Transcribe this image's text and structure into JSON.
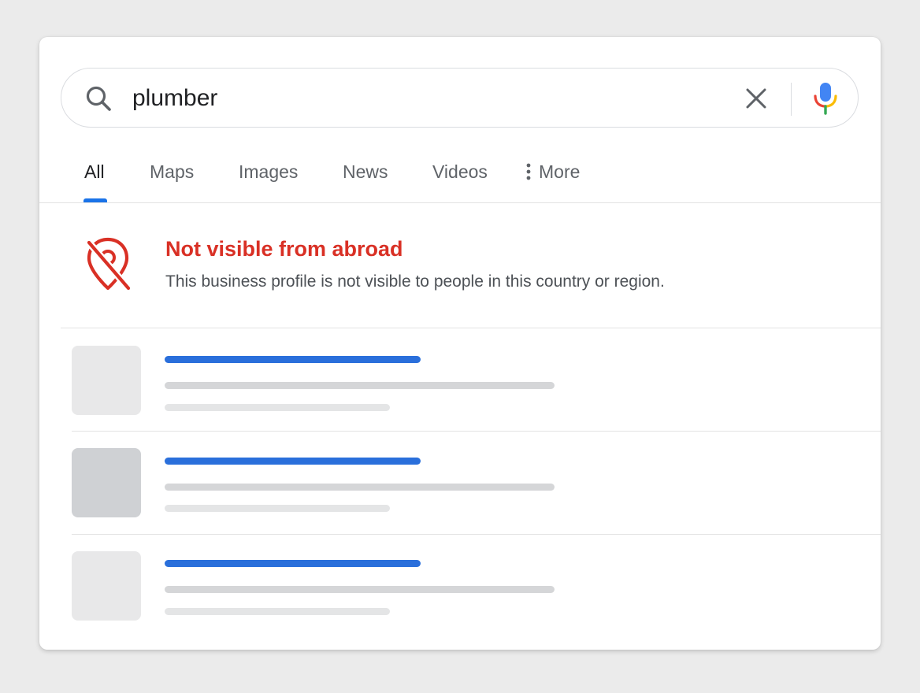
{
  "search": {
    "query": "plumber",
    "icons": {
      "search": "search-icon",
      "clear": "close-icon",
      "voice": "microphone-icon"
    }
  },
  "tabs": [
    {
      "label": "All",
      "active": true
    },
    {
      "label": "Maps",
      "active": false
    },
    {
      "label": "Images",
      "active": false
    },
    {
      "label": "News",
      "active": false
    },
    {
      "label": "Videos",
      "active": false
    },
    {
      "label": "More",
      "active": false,
      "icon": "more-vert-icon"
    }
  ],
  "notice": {
    "icon": "location-off-icon",
    "title": "Not visible from abroad",
    "text": "This business profile is not visible to people in this country or region."
  },
  "colors": {
    "accent": "#1a73e8",
    "warning": "#d93025",
    "skeleton_title": "#2a6fdb",
    "skeleton_line": "#d5d6d8"
  }
}
